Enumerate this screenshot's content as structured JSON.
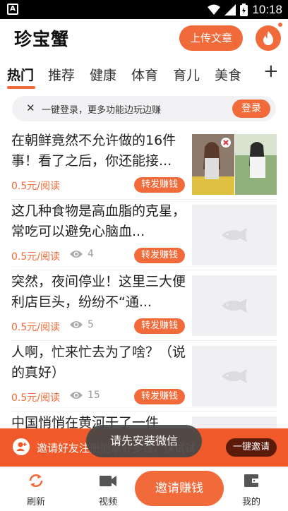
{
  "status_bar": {
    "time": "10:18"
  },
  "header": {
    "app_title": "珍宝蟹",
    "upload_label": "上传文章"
  },
  "tabs": [
    "热门",
    "推荐",
    "健康",
    "体育",
    "育儿",
    "美食"
  ],
  "login_banner": {
    "text": "一键登录，更多功能边玩边赚",
    "button_label": "登录"
  },
  "articles": [
    {
      "title": "在朝鲜竟然不允许做的16件事！看了之后，你还能接...",
      "price": "0.5元/阅读",
      "views": "",
      "share_label": "转发赚钱",
      "thumb": "photo"
    },
    {
      "title": "这几种食物是高血脂的克星，常吃可以避免心脑血...",
      "price": "0.5元/阅读",
      "views": "4",
      "share_label": "转发赚钱",
      "thumb": "placeholder"
    },
    {
      "title": "突然，夜间停业！这里三大便利店巨头，纷纷不“通...",
      "price": "0.5元/阅读",
      "views": "5",
      "share_label": "转发赚钱",
      "thumb": "placeholder"
    },
    {
      "title": "人啊，忙来忙去为了啥？（说的真好）",
      "price": "0.5元/阅读",
      "views": "15",
      "share_label": "转发赚钱",
      "thumb": "placeholder"
    },
    {
      "title": "中国悄悄在黄河干了一件",
      "price": "",
      "views": "",
      "share_label": "",
      "thumb": "placeholder"
    }
  ],
  "invite_bar": {
    "text": "邀请好友注册能拿好多钱，快试试",
    "button_label": "一键邀请"
  },
  "toast": {
    "text": "请先安装微信"
  },
  "bottom_nav": {
    "refresh": "刷新",
    "video": "视频",
    "invite": "邀请赚钱",
    "mine": "我的"
  },
  "colors": {
    "accent": "#f06a3a",
    "invite_bar": "#f05a2a"
  }
}
